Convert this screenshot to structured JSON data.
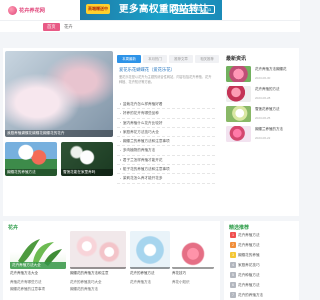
{
  "logo": {
    "text": "花卉养花网"
  },
  "banner": {
    "badge": "高端赠送中",
    "slogan": "更多高权重网站转让",
    "contact": "联系QQ:411021133"
  },
  "nav": [
    {
      "label": "首页",
      "active": true
    },
    {
      "label": "花卉",
      "active": false
    }
  ],
  "carousel": {
    "main_caption": "我庭养殖蝴蝶花蝴蝶花蝴蝶花的花卉"
  },
  "thumbs": [
    {
      "caption": "蝴蝶花的养殖方法"
    },
    {
      "caption": "雪莲花能在家里养吗"
    }
  ],
  "tabs": [
    {
      "label": "本周最新",
      "active": true
    },
    {
      "label": "本月热门",
      "active": false
    },
    {
      "label": "推荐文章",
      "active": false
    },
    {
      "label": "相关推荐",
      "active": false
    }
  ],
  "feature": {
    "title": "爱花乐花蝴蝶花（爱花乐花）",
    "description": "爱花乐花是以花卉为主题的综合性网站，内容包括花卉养殖、花卉种植、花卉知识等方面。"
  },
  "feature_list": [
    "盆栽花卉怎么样养殖好看",
    "好养的花卉有哪些品种",
    "室内养殖什么花卉比较好",
    "家庭养花方法技巧大全",
    "蝴蝶兰的养殖方法和注意事项",
    "多肉植物的养殖方法",
    "君子兰怎样养殖才能开花",
    "栀子花的养殖方法和注意事项",
    "茉莉花怎么养才能开花多"
  ],
  "side": {
    "title": "最新资讯",
    "items": [
      {
        "title": "花卉养殖方法蝴蝶花",
        "date": "2023-06-30"
      },
      {
        "title": "花卉养殖的方法",
        "date": "2023-06-28"
      },
      {
        "title": "雪莲花养殖方法",
        "date": "2023-06-25"
      },
      {
        "title": "蝴蝶兰养殖的方法",
        "date": "2023-06-22"
      }
    ]
  },
  "flowers": {
    "title": "花卉"
  },
  "flower_cards": [
    {
      "caption": "花卉养殖方法大全"
    },
    {
      "caption": ""
    },
    {
      "caption": ""
    },
    {
      "caption": ""
    }
  ],
  "flower_meta": [
    {
      "title": "花卉养殖方法大全"
    },
    {
      "title": "蝴蝶花的养殖方法和注意"
    },
    {
      "title": "花卉的养殖方法"
    },
    {
      "title": "养花技巧"
    }
  ],
  "flower_lists": [
    [
      "养殖花卉有哪些方法",
      "蝴蝶花养殖的注意事项"
    ],
    [
      "花卉的养殖技巧大全",
      "蝴蝶花的养殖方法"
    ],
    [
      "花卉养殖方法"
    ],
    [
      "养花小知识"
    ]
  ],
  "recommend": {
    "title": "精选推荐",
    "items": [
      "花卉养殖方法",
      "花卉养殖方法",
      "蝴蝶花的养殖",
      "家庭养花技巧",
      "花卉种植方法",
      "花卉养殖方法",
      "花卉的养殖方法"
    ]
  }
}
